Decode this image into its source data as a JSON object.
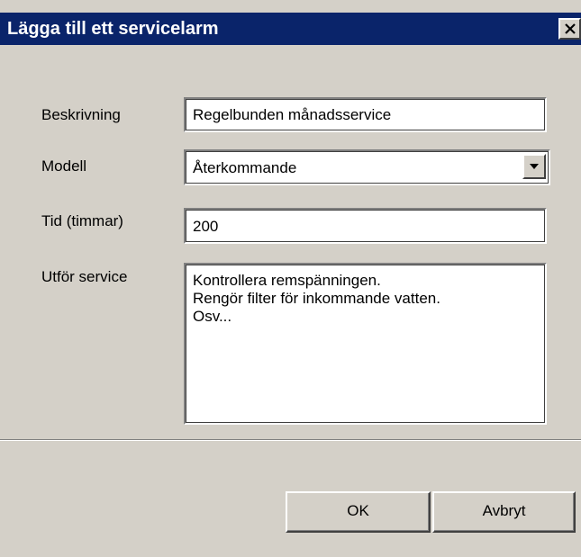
{
  "window": {
    "title": "Lägga till ett servicelarm"
  },
  "form": {
    "description": {
      "label": "Beskrivning",
      "value": "Regelbunden månadsservice"
    },
    "model": {
      "label": "Modell",
      "selected": "Återkommande"
    },
    "time": {
      "label": "Tid (timmar)",
      "value": "200"
    },
    "service": {
      "label": "Utför service",
      "lines": [
        "Kontrollera remspänningen.",
        "Rengör filter för inkommande vatten.",
        "Osv..."
      ]
    }
  },
  "buttons": {
    "ok": "OK",
    "cancel": "Avbryt"
  },
  "colors": {
    "titlebar": "#0a246a",
    "face": "#d4d0c8"
  },
  "icons": {
    "close": "close-icon",
    "dropdown": "chevron-down-icon"
  }
}
